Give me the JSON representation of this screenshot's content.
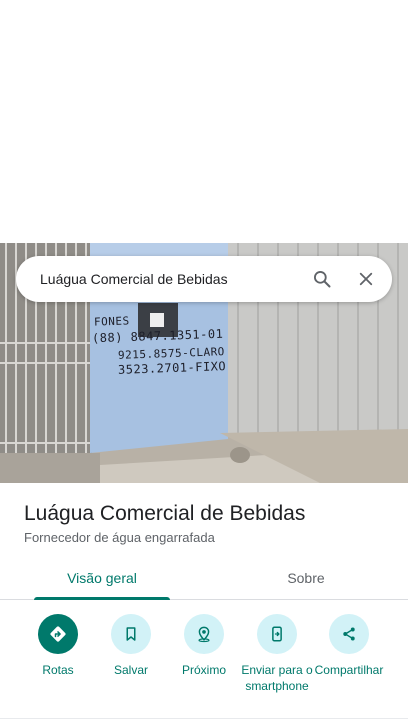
{
  "search": {
    "query": "Luágua Comercial de Bebidas",
    "search_icon": "search-icon",
    "close_icon": "close-icon"
  },
  "photo": {
    "wall_text": [
      "FONES",
      "(88) 8847.1351-01",
      "9215.8575-CLARO",
      "3523.2701-FIXO"
    ]
  },
  "place": {
    "title": "Luágua Comercial de Bebidas",
    "category": "Fornecedor de água engarrafada"
  },
  "tabs": [
    {
      "label": "Visão geral",
      "active": true
    },
    {
      "label": "Sobre",
      "active": false
    }
  ],
  "actions": [
    {
      "label": "Rotas",
      "icon": "directions-icon"
    },
    {
      "label": "Salvar",
      "icon": "bookmark-icon"
    },
    {
      "label": "Próximo",
      "icon": "nearby-icon"
    },
    {
      "label": "Enviar para o smartphone",
      "icon": "send-to-phone-icon"
    },
    {
      "label": "Compartilhar",
      "icon": "share-icon"
    }
  ],
  "colors": {
    "accent": "#00796b",
    "action_circle": "#d2f2f7",
    "text_primary": "#202124",
    "text_secondary": "#5f6368"
  }
}
